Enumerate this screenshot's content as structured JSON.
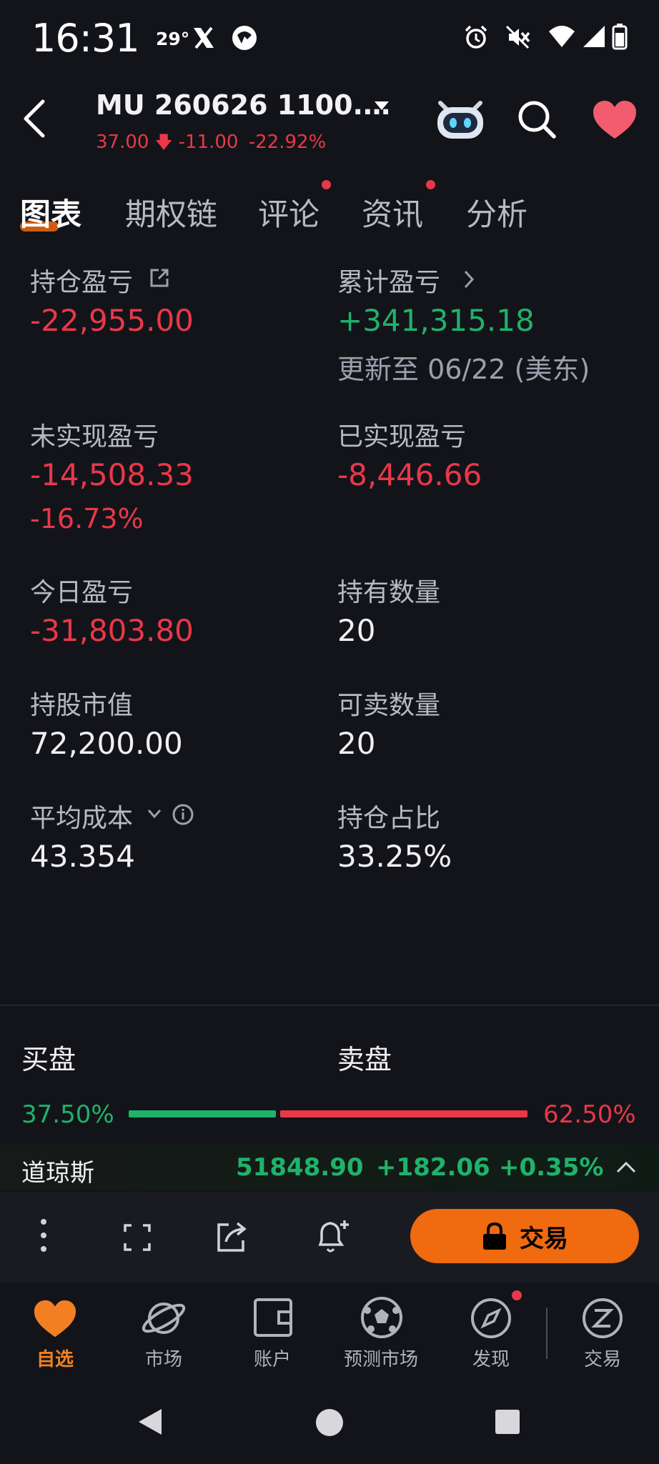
{
  "status": {
    "time": "16:31",
    "temp": "29°"
  },
  "header": {
    "title": "MU 260626 1100.…",
    "price": "37.00",
    "change": "-11.00",
    "change_pct": "-22.92%"
  },
  "tabs": [
    {
      "label": "图表",
      "active": true
    },
    {
      "label": "期权链",
      "active": false
    },
    {
      "label": "评论",
      "active": false,
      "dot": true
    },
    {
      "label": "资讯",
      "active": false,
      "dot": true
    },
    {
      "label": "分析",
      "active": false
    }
  ],
  "stats": {
    "position_pl_label": "持仓盈亏",
    "position_pl": "-22,955.00",
    "cumulative_pl_label": "累计盈亏",
    "cumulative_pl": "+341,315.18",
    "updated": "更新至 06/22 (美东)",
    "unrealized_label": "未实现盈亏",
    "unrealized": "-14,508.33",
    "unrealized_pct": "-16.73%",
    "realized_label": "已实现盈亏",
    "realized": "-8,446.66",
    "today_label": "今日盈亏",
    "today": "-31,803.80",
    "hold_qty_label": "持有数量",
    "hold_qty": "20",
    "market_value_label": "持股市值",
    "market_value": "72,200.00",
    "sellable_label": "可卖数量",
    "sellable": "20",
    "avg_cost_label": "平均成本",
    "avg_cost": "43.354",
    "ratio_label": "持仓占比",
    "ratio": "33.25%"
  },
  "orderbook": {
    "buy_label": "买盘",
    "sell_label": "卖盘",
    "buy_pct": "37.50%",
    "sell_pct": "62.50%",
    "buy_fraction": 0.375
  },
  "ticker": {
    "name": "道琼斯",
    "value": "51848.90",
    "change": "+182.06",
    "pct": "+0.35%"
  },
  "toolbar": {
    "trade_label": "交易"
  },
  "nav": [
    {
      "label": "自选",
      "icon": "heart-icon",
      "active": true
    },
    {
      "label": "市场",
      "icon": "planet-icon",
      "active": false
    },
    {
      "label": "账户",
      "icon": "wallet-icon",
      "active": false
    },
    {
      "label": "预测市场",
      "icon": "soccer-ball-icon",
      "active": false
    },
    {
      "label": "发现",
      "icon": "compass-icon",
      "active": false
    },
    {
      "label": "交易",
      "icon": "trade-icon",
      "active": false
    }
  ],
  "colors": {
    "red": "#e8384a",
    "green": "#1fb26b",
    "accent": "#f06a10"
  }
}
